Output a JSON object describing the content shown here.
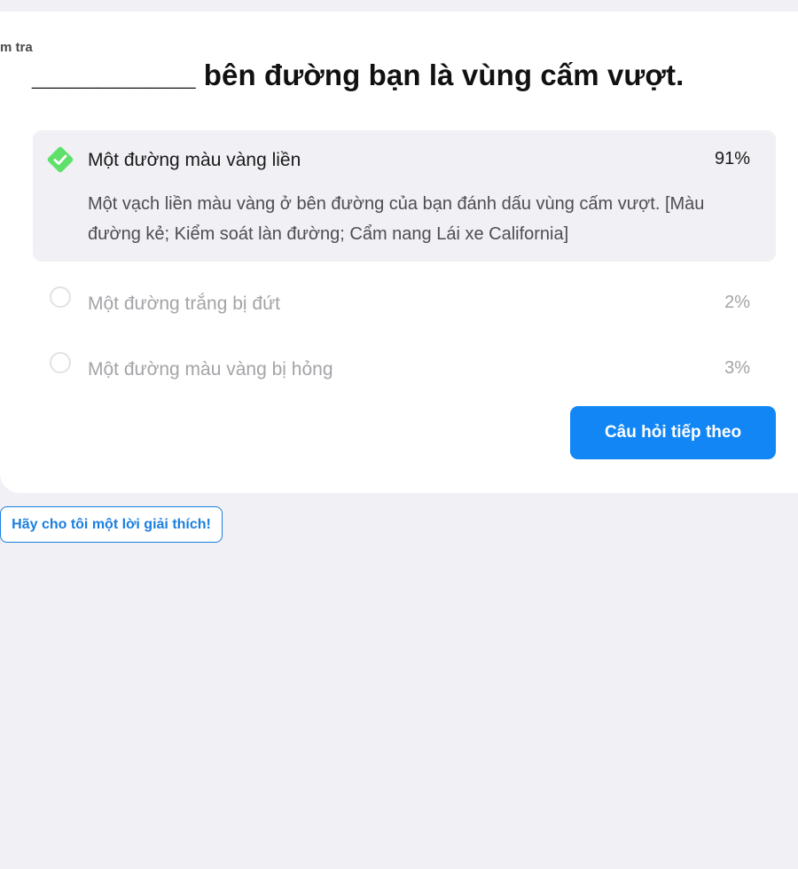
{
  "breadcrumb": "m tra",
  "question": "__________ bên đường bạn là vùng cấm vượt.",
  "answers": [
    {
      "label": "Một đường màu vàng liền",
      "percent": "91%",
      "correct": true,
      "explanation": "Một vạch liền màu vàng ở bên đường của bạn đánh dấu vùng cấm vượt. [Màu đường kẻ; Kiểm soát làn đường; Cẩm nang Lái xe California]"
    },
    {
      "label": "Một đường trắng bị đứt",
      "percent": "2%",
      "correct": false
    },
    {
      "label": "Một đường màu vàng bị hỏng",
      "percent": "3%",
      "correct": false
    }
  ],
  "next_button": "Câu hỏi tiếp theo",
  "explain_button": "Hãy cho tôi một lời giải thích!",
  "colors": {
    "accent": "#1286f4",
    "correct_green": "#5ee06a",
    "page_bg": "#f0f0f5"
  }
}
